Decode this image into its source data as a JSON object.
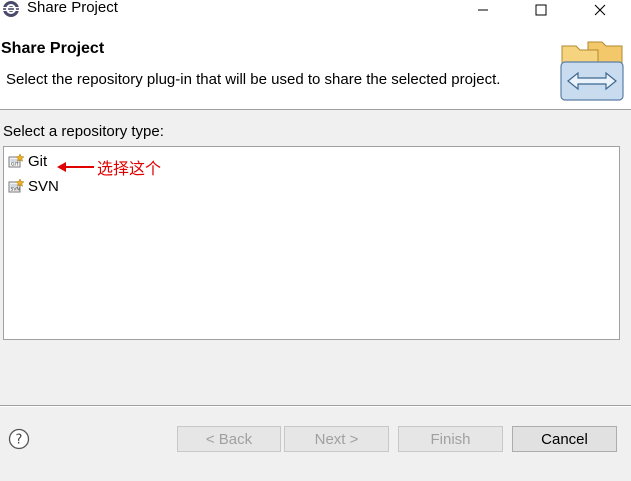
{
  "window": {
    "title": "Share Project",
    "minimize_glyph": "—",
    "maximize_glyph": "☐",
    "close_glyph": "✕"
  },
  "banner": {
    "title": "Share Project",
    "description": "Select the repository plug-in that will be used to share the selected project.",
    "icon": "share-folders-icon"
  },
  "repository": {
    "label": "Select a repository type:",
    "items": [
      {
        "label": "Git",
        "icon": "git-repository-icon"
      },
      {
        "label": "SVN",
        "icon": "svn-repository-icon"
      }
    ],
    "annotation": "选择这个"
  },
  "footer": {
    "help_icon": "help-icon",
    "back_label": "< Back",
    "next_label": "Next >",
    "finish_label": "Finish",
    "cancel_label": "Cancel"
  },
  "colors": {
    "annotation": "#e00000",
    "disabled_text": "#a0a0a0"
  }
}
